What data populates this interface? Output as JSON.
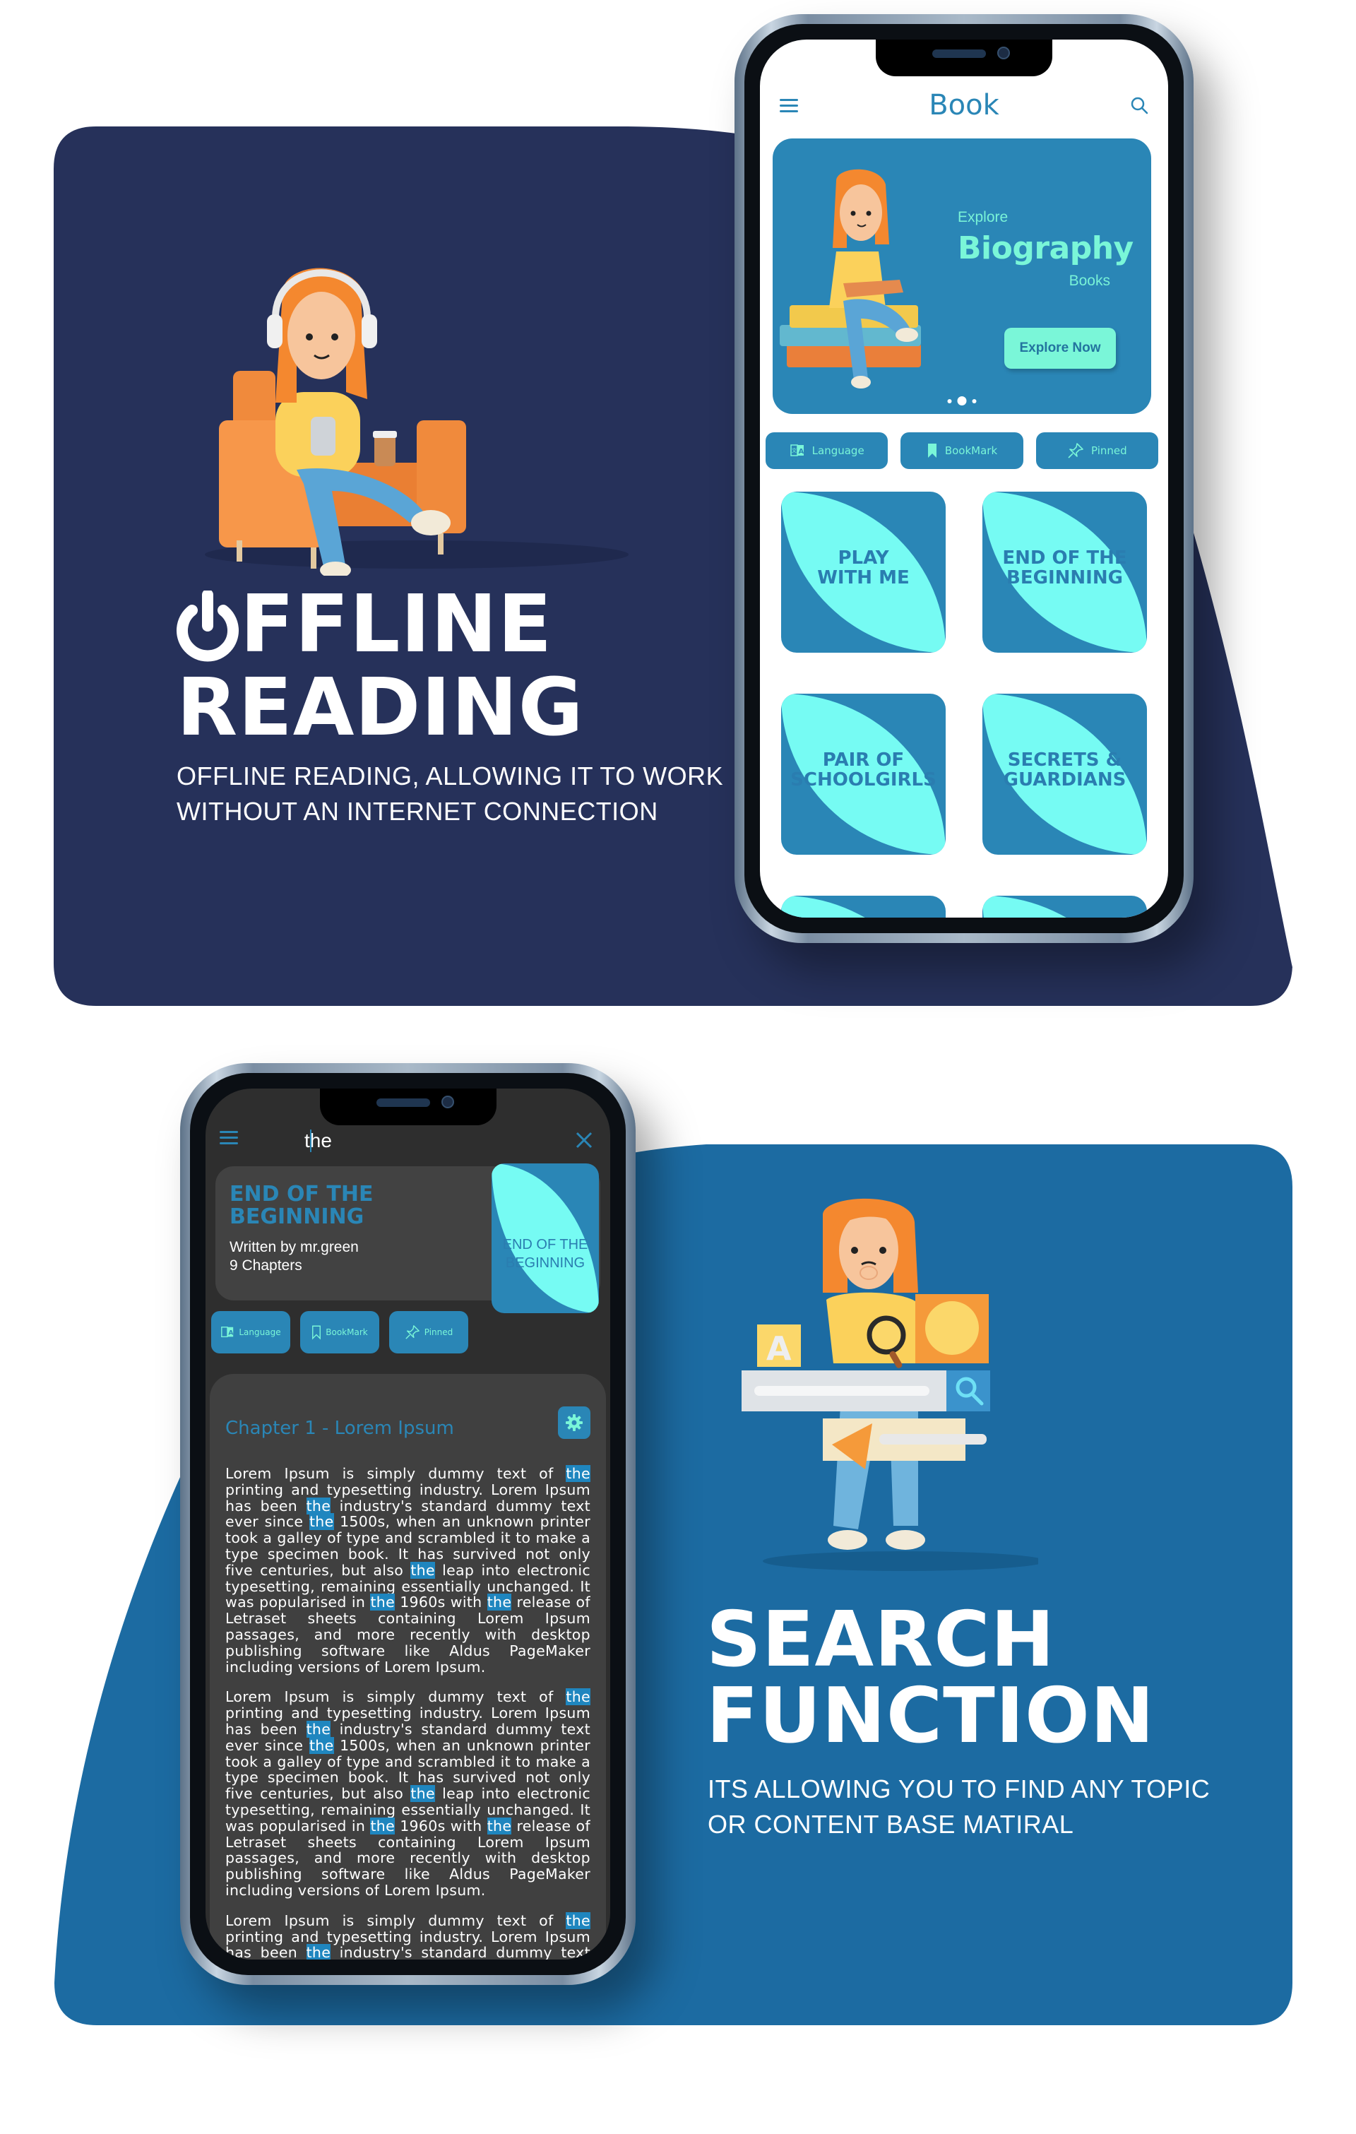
{
  "colors": {
    "panel_navy": "#26315a",
    "panel_blue": "#1c6ba2",
    "accent_blue": "#2a86b6",
    "mint": "#7af6d8",
    "cyan_cover": "#76fbf3",
    "dark_bg": "#2e2e2e",
    "highlight": "#1f86bf"
  },
  "section_offline": {
    "headline_line1": "OFFLINE",
    "headline_line1_rest": "FFLINE",
    "headline_line2": "READING",
    "subtitle_line1": "OFFLINE READING, ALLOWING IT TO WORK",
    "subtitle_line2": "WITHOUT AN INTERNET CONNECTION",
    "title_icon": "power-icon",
    "illustration": "girl-in-armchair-with-headphones"
  },
  "phone_home": {
    "menu_icon": "hamburger-icon",
    "title": "Book",
    "search_icon": "search-icon",
    "hero": {
      "pre": "Explore",
      "title": "Biography",
      "post": "Books",
      "button": "Explore Now",
      "illustration": "girl-reading-on-books",
      "carousel_index": 2,
      "carousel_count": 3
    },
    "chips": [
      {
        "label": "Language",
        "icon": "translate-icon"
      },
      {
        "label": "BookMark",
        "icon": "bookmark-icon"
      },
      {
        "label": "Pinned",
        "icon": "pin-icon"
      }
    ],
    "books": [
      {
        "title_l1": "PLAY",
        "title_l2": "WITH ME"
      },
      {
        "title_l1": "END OF THE",
        "title_l2": "BEGINNING"
      },
      {
        "title_l1": "PAIR OF",
        "title_l2": "SCHOOLGIRLS"
      },
      {
        "title_l1": "SECRETS &",
        "title_l2": "GUARDIANS"
      },
      {
        "title_l1": "",
        "title_l2": ""
      },
      {
        "title_l1": "",
        "title_l2": ""
      }
    ]
  },
  "section_search": {
    "headline_line1": "SEARCH",
    "headline_line2": "FUNCTION",
    "subtitle_line1": "ITS ALLOWING YOU TO FIND ANY TOPIC",
    "subtitle_line2": "OR CONTENT BASE MATIRAL",
    "illustration": "girl-with-magnifier-and-search-bar"
  },
  "phone_reader": {
    "menu_icon": "hamburger-icon",
    "search_query": "the",
    "close_icon": "close-icon",
    "book": {
      "title_l1": "END OF THE",
      "title_l2": "BEGINNING",
      "author": "Written by mr.green",
      "chapters": "9 Chapters",
      "cover_l1": "END OF THE",
      "cover_l2": "BEGINNING"
    },
    "chips": [
      {
        "label": "Language",
        "icon": "translate-icon"
      },
      {
        "label": "BookMark",
        "icon": "bookmark-icon"
      },
      {
        "label": "Pinned",
        "icon": "pin-icon"
      }
    ],
    "chapter_title": "Chapter 1 - Lorem Ipsum",
    "settings_icon": "gear-icon",
    "highlight_term": "the",
    "paragraph": "Lorem Ipsum is simply dummy text of the printing and typesetting industry. Lorem Ipsum has been the industry's standard dummy text ever since the 1500s, when an unknown printer took a galley of type and scrambled it to make a type specimen book. It has survived not only five centuries, but also the leap into electronic typesetting, remaining essentially unchanged. It was popularised in the 1960s with the release of Letraset sheets containing Lorem Ipsum passages, and more recently with desktop publishing software like Aldus PageMaker including versions of Lorem Ipsum.",
    "paragraph_count": 3
  }
}
